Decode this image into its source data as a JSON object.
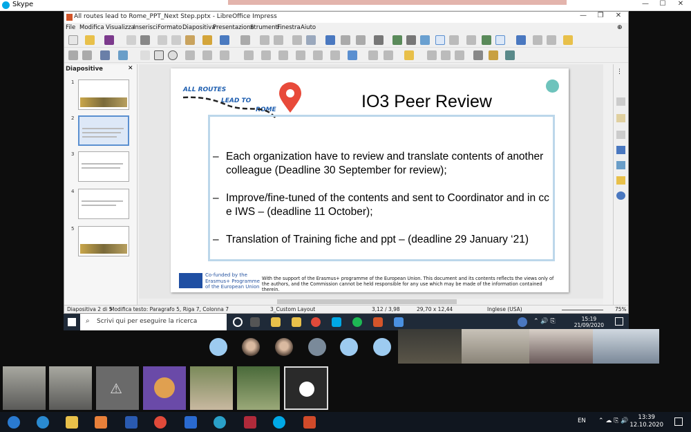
{
  "skype": {
    "title": "Skype"
  },
  "window": {
    "title": "All routes lead to Rome_PPT_Next Step.pptx - LibreOffice Impress"
  },
  "menu": [
    "File",
    "Modifica",
    "Visualizza",
    "Inserisci",
    "Formato",
    "Diapositiva",
    "Presentazione",
    "Strumenti",
    "Finestra",
    "Aiuto"
  ],
  "sidebar": {
    "header": "Diapositive",
    "slides": [
      "1",
      "2",
      "3",
      "4",
      "5"
    ]
  },
  "slide": {
    "title": "IO3 Peer Review",
    "logo_line1": "ALL ROUTES",
    "logo_line2": "LEAD TO",
    "logo_line3": "ROME",
    "bullets": [
      "Each organization have to review and translate contents of another colleague (Deadline 30 September for review);",
      "Improve/fine-tuned of the contents and sent to Coordinator and in cc e IWS – (deadline 11 October);",
      " Translation of Training fiche and ppt – (deadline 29 January ‘21)"
    ],
    "footer_logo_text": "Co-funded by the Erasmus+ Programme of the European Union",
    "footer_text": "With the support of the Erasmus+ programme of the European Union. This document and its contents reflects the views only of the authors, and the Commission cannot be held responsible for any use which may be made of the information contained therein."
  },
  "status": {
    "slide": "Diapositiva 2 di 5",
    "edit": "Modifica testo: Paragrafo 5, Riga 7, Colonna 7",
    "layout": "3_Custom Layout",
    "pos": "3,12 / 3,98",
    "size": "29,70 x 12,44",
    "lang": "Inglese (USA)",
    "zoom": "75%"
  },
  "remote_taskbar": {
    "search": "Scrivi qui per eseguire la ricerca",
    "time": "15:19",
    "date": "21/09/2020"
  },
  "win_taskbar": {
    "lang": "EN",
    "time": "13:39",
    "date": "12.10.2020"
  },
  "colors": {
    "accent": "#5a8fd0",
    "taskbar": "#10161f",
    "slide_border": "#bcd7ea"
  },
  "icons": [
    "skype-icon",
    "windows-start-icon",
    "search-icon",
    "chrome-icon",
    "spotify-icon",
    "powerpoint-icon",
    "outlook-icon",
    "word-icon",
    "edge-icon",
    "ie-icon",
    "folder-icon",
    "warning-icon",
    "speaker-icon",
    "network-icon"
  ]
}
